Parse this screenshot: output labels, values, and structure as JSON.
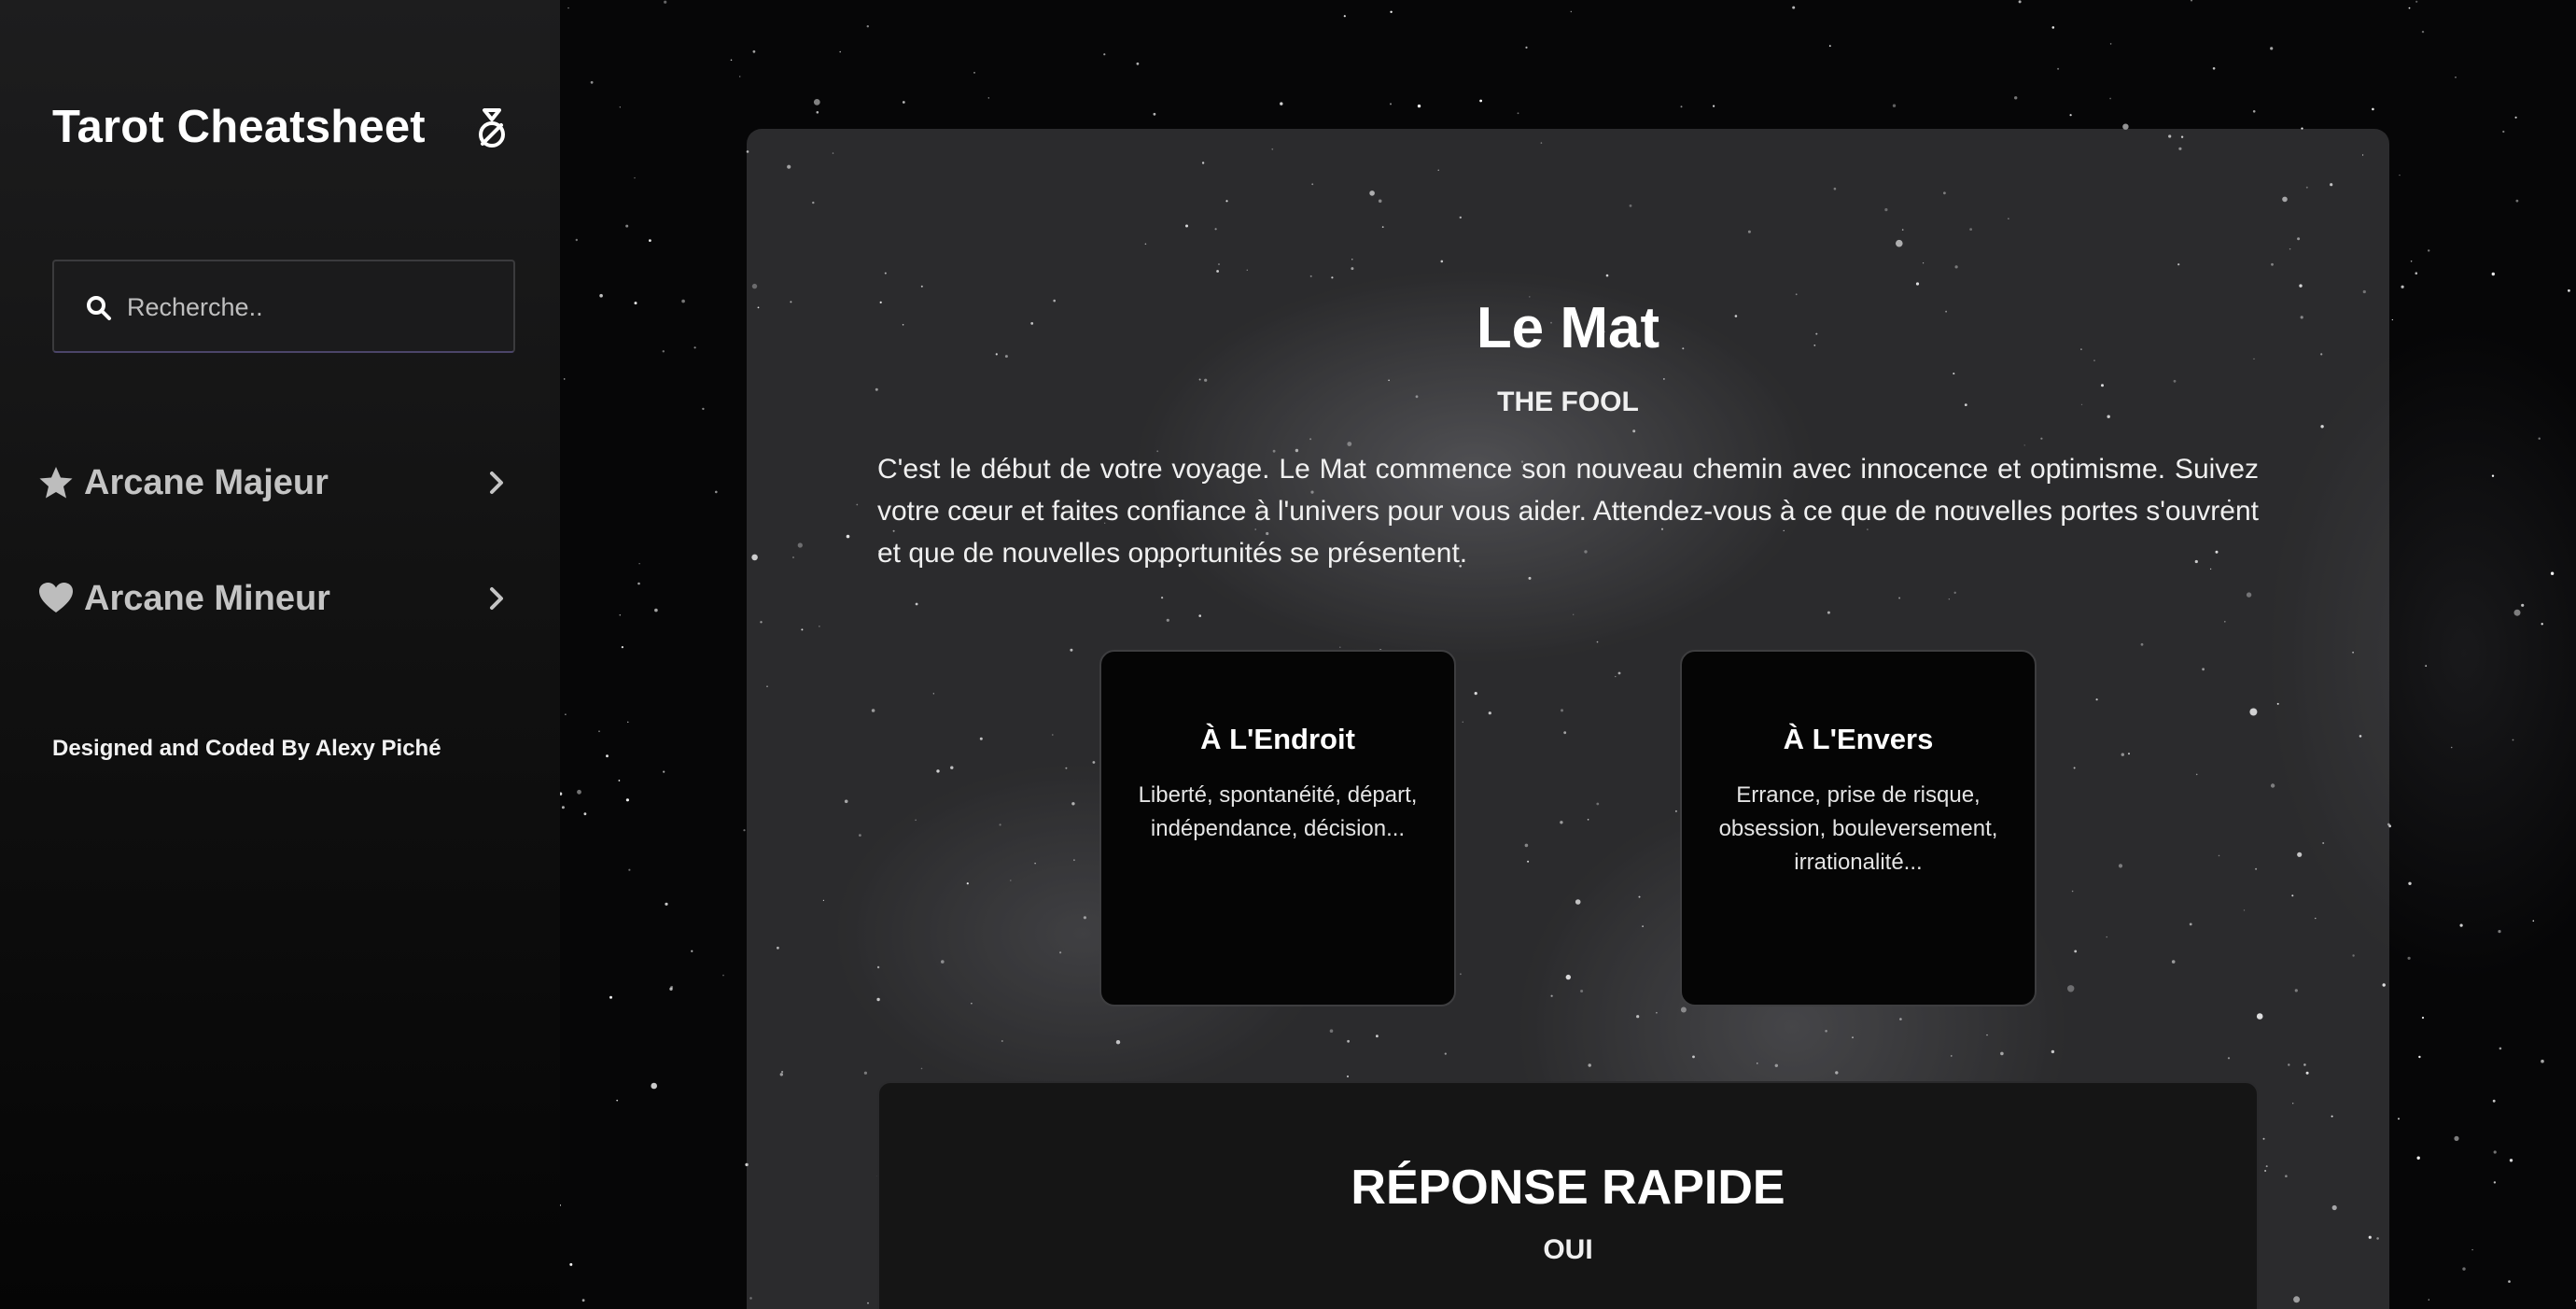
{
  "sidebar": {
    "brand": "Tarot Cheatsheet",
    "brand_icon": "pendulum-icon",
    "search": {
      "placeholder": "Recherche..",
      "value": "",
      "icon": "search-icon"
    },
    "nav": [
      {
        "label": "Arcane Majeur",
        "icon": "star-icon"
      },
      {
        "label": "Arcane Mineur",
        "icon": "heart-icon"
      }
    ],
    "credit": "Designed and Coded By Alexy Piché"
  },
  "card": {
    "title": "Le Mat",
    "subtitle": "THE FOOL",
    "description": "C'est le début de votre voyage. Le Mat commence son nouveau chemin avec innocence et optimisme. Suivez votre cœur et faites confiance à l'univers pour vous aider. Attendez-vous à ce que de nouvelles portes s'ouvrent et que de nouvelles opportunités se présentent.",
    "upright": {
      "title": "À L'Endroit",
      "text": "Liberté, spontanéité, départ, indépendance, décision..."
    },
    "reversed": {
      "title": "À L'Envers",
      "text": "Errance, prise de risque, obsession, bouleversement, irrationalité..."
    }
  },
  "quick_answer": {
    "title": "RÉPONSE RAPIDE",
    "answer": "OUI"
  },
  "colors": {
    "sidebar_bg": "#1d1d1e",
    "card_bg": "#050505",
    "text": "#ffffff"
  }
}
